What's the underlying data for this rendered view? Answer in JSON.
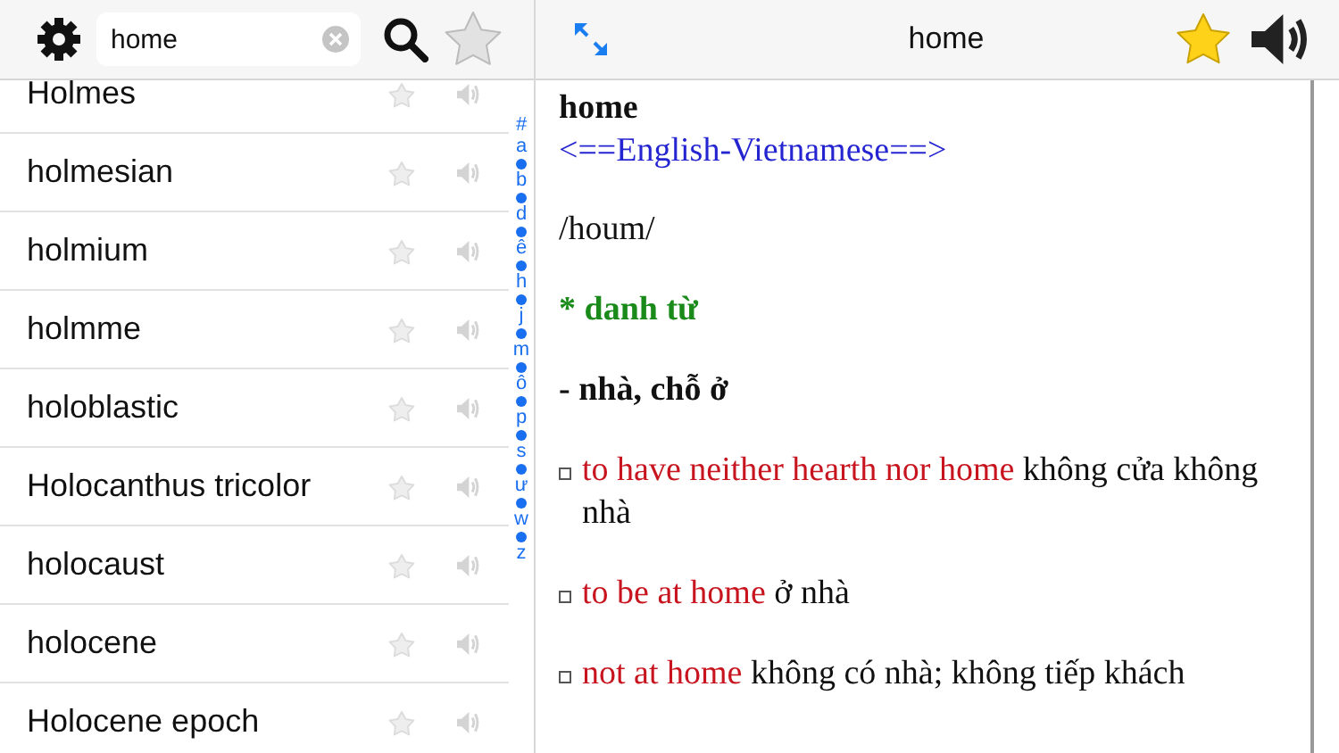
{
  "search": {
    "value": "home"
  },
  "words": [
    {
      "text": "Holmes"
    },
    {
      "text": "holmesian"
    },
    {
      "text": "holmium"
    },
    {
      "text": "holmme"
    },
    {
      "text": "holoblastic"
    },
    {
      "text": "Holocanthus tricolor"
    },
    {
      "text": "holocaust"
    },
    {
      "text": "holocene"
    },
    {
      "text": "Holocene epoch"
    }
  ],
  "index": [
    "#",
    "a",
    "b",
    "d",
    "ê",
    "h",
    "j",
    "m",
    "ô",
    "p",
    "s",
    "ư",
    "w",
    "z"
  ],
  "header": {
    "title": "home",
    "favorite": true
  },
  "entry": [
    {
      "kind": "headword",
      "text": "home"
    },
    {
      "kind": "dict",
      "text": "<==English-Vietnamese==>"
    },
    {
      "kind": "phonetic",
      "text": "/houm/"
    },
    {
      "kind": "pos",
      "text": "* danh từ"
    },
    {
      "kind": "sense",
      "text": "- nhà, chỗ ở"
    },
    {
      "kind": "example",
      "phrase": "to have neither hearth nor home",
      "meaning": "không cửa không nhà"
    },
    {
      "kind": "example",
      "phrase": "to be at home",
      "meaning": "ở nhà"
    },
    {
      "kind": "example",
      "phrase": "not at home",
      "meaning": "không có nhà; không tiếp khách"
    }
  ]
}
